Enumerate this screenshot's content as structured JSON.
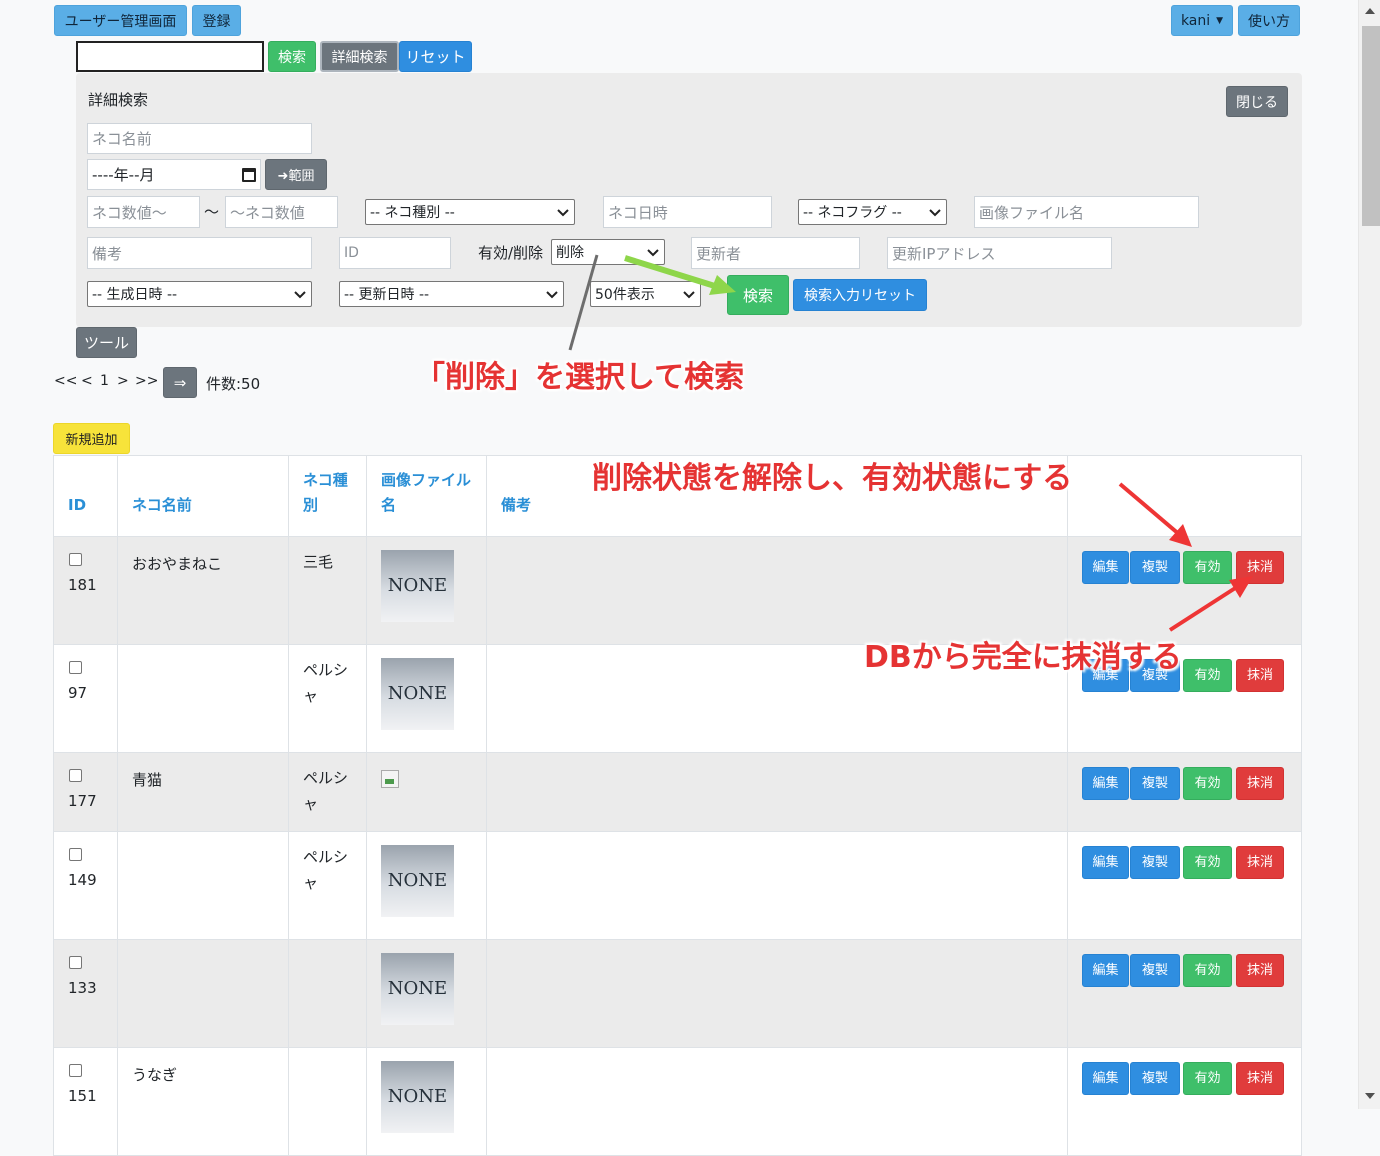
{
  "topnav": {
    "user_admin": "ユーザー管理画面",
    "register": "登録",
    "user": "kani",
    "help": "使い方"
  },
  "search": {
    "search_btn": "検索",
    "detail_btn": "詳細検索",
    "reset_btn": "リセット"
  },
  "detail": {
    "title": "詳細検索",
    "close_btn": "閉じる",
    "neko_name_ph": "ネコ名前",
    "month_value": "----年--月",
    "range_btn": "➜範囲",
    "num_from_ph": "ネコ数値～",
    "tilde": "～",
    "num_to_ph": "～ネコ数値",
    "type_select": "-- ネコ種別 --",
    "datetime_ph": "ネコ日時",
    "flag_select": "-- ネコフラグ --",
    "image_ph": "画像ファイル名",
    "note_ph": "備考",
    "id_ph": "ID",
    "status_label": "有効/削除",
    "status_select": "削除",
    "updater_ph": "更新者",
    "update_ip_ph": "更新IPアドレス",
    "created_select": "-- 生成日時 --",
    "updated_select": "-- 更新日時 --",
    "perpage_select": "50件表示",
    "submit_btn": "検索",
    "input_reset_btn": "検索入力リセット"
  },
  "tool_btn": "ツール",
  "pager": {
    "first": "<<",
    "prev": "<",
    "page": "1",
    "next": ">",
    "last": ">>",
    "go": "⇒",
    "count": "件数:50"
  },
  "new_btn": "新規追加",
  "table": {
    "headers": [
      "ID",
      "ネコ名前",
      "ネコ種別",
      "画像ファイル名",
      "備考"
    ],
    "action_labels": {
      "edit": "編集",
      "copy": "複製",
      "enable": "有効",
      "erase": "抹消"
    },
    "none_label": "NONE",
    "rows": [
      {
        "id": "181",
        "name": "おおやまねこ",
        "type": "三毛",
        "image": "none",
        "note": ""
      },
      {
        "id": "97",
        "name": "",
        "type": "ペルシャ",
        "image": "none",
        "note": ""
      },
      {
        "id": "177",
        "name": "青猫",
        "type": "ペルシャ",
        "image": "broken",
        "note": ""
      },
      {
        "id": "149",
        "name": "",
        "type": "ペルシャ",
        "image": "none",
        "note": ""
      },
      {
        "id": "133",
        "name": "",
        "type": "",
        "image": "none",
        "note": ""
      },
      {
        "id": "151",
        "name": "うなぎ",
        "type": "",
        "image": "none",
        "note": ""
      }
    ]
  },
  "annotations": {
    "a1": "「削除」を選択して検索",
    "a2": "削除状態を解除し、有効状態にする",
    "a3": "DBから完全に抹消する"
  }
}
